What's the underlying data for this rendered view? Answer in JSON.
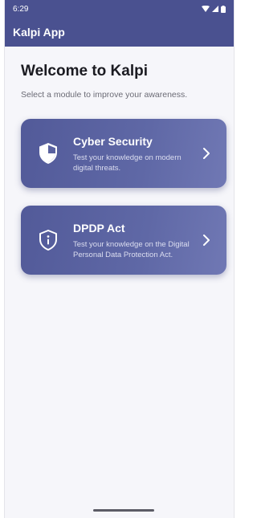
{
  "status_bar": {
    "time": "6:29",
    "icons": [
      "wifi-icon",
      "signal-icon",
      "battery-icon"
    ]
  },
  "app_bar": {
    "title": "Kalpi App",
    "background": "#4a5190"
  },
  "main": {
    "title": "Welcome to Kalpi",
    "subtitle": "Select a module to improve your awareness.",
    "modules": [
      {
        "icon": "shield-icon",
        "title": "Cyber Security",
        "description": "Test your knowledge on modern digital threats."
      },
      {
        "icon": "info-shield-icon",
        "title": "DPDP Act",
        "description": "Test your knowledge on the Digital Personal Data Protection Act."
      }
    ]
  },
  "colors": {
    "accent": "#4a5190",
    "card_start": "#525a99",
    "card_end": "#7078b4"
  }
}
